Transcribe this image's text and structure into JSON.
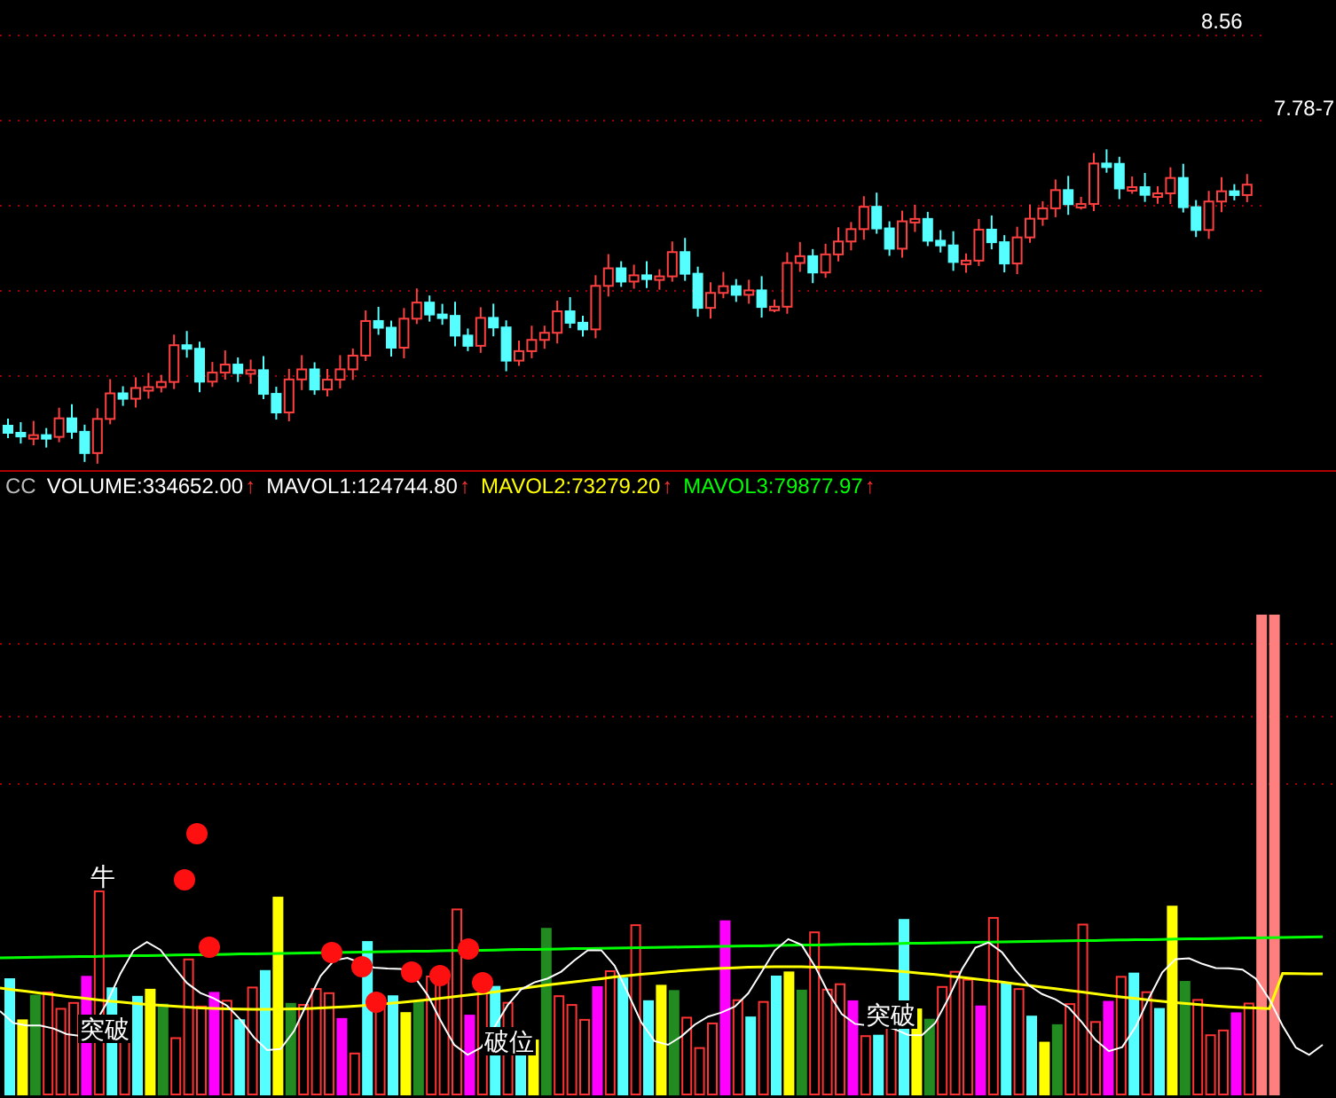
{
  "price_panel": {
    "high_label": "8.56",
    "low_label": "7.78-7"
  },
  "volume_panel": {
    "indicator_name": "CC",
    "readings": [
      {
        "text": "VOLUME:334652.00",
        "arrow": "↑",
        "color": "#ffffff"
      },
      {
        "text": "MAVOL1:124744.80",
        "arrow": "↑",
        "color": "#ffffff"
      },
      {
        "text": "MAVOL2:73279.20",
        "arrow": "↑",
        "color": "#ffff00"
      },
      {
        "text": "MAVOL3:79877.97",
        "arrow": "↑",
        "color": "#00ff00"
      }
    ],
    "signals": [
      {
        "text": "牛"
      },
      {
        "text": "突破"
      },
      {
        "text": "破位"
      },
      {
        "text": "突破"
      }
    ]
  }
}
